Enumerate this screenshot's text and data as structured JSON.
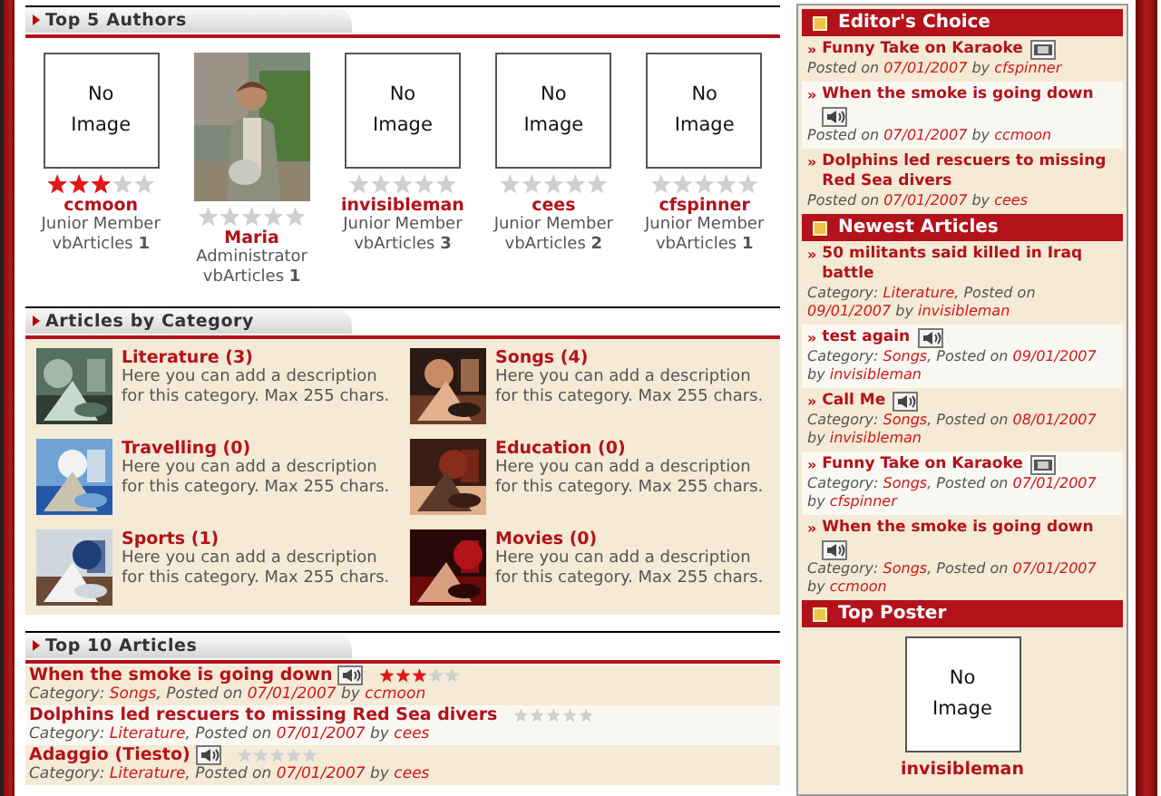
{
  "top_authors": {
    "title": "Top 5 Authors",
    "authors": [
      {
        "avatar": {
          "kind": "none",
          "text": "No Image"
        },
        "stars": 3,
        "name": "ccmoon",
        "role": "Junior Member",
        "articles": "vbArticles **1**"
      },
      {
        "stars": 0,
        "name": "Maria",
        "role": "Administrator",
        "articles": "vbArticles **1**"
      },
      {
        "avatar": {
          "kind": "none",
          "text": "No Image"
        },
        "stars": 0,
        "name": "invisibleman",
        "role": "Junior Member",
        "articles": "vbArticles **3**"
      },
      {
        "avatar": {
          "kind": "none",
          "text": "No Image"
        },
        "stars": 0,
        "name": "cees",
        "role": "Junior Member",
        "articles": "vbArticles **2**"
      },
      {
        "avatar": {
          "kind": "none",
          "text": "No Image"
        },
        "stars": 0,
        "name": "cfspinner",
        "role": "Junior Member",
        "articles": "vbArticles **1**"
      }
    ]
  },
  "categories": {
    "title": "Articles by Category",
    "items": [
      {
        "name": "Literature (3)",
        "description": "Here you can add a description for this category. Max 255 chars."
      },
      {
        "name": "Songs (4)",
        "description": "Here you can add a description for this category. Max 255 chars."
      },
      {
        "name": "Travelling (0)",
        "description": "Here you can add a description for this category. Max 255 chars."
      },
      {
        "name": "Education (0)",
        "description": "Here you can add a description for this category. Max 255 chars."
      },
      {
        "name": "Sports (1)",
        "description": "Here you can add a description for this category. Max 255 chars."
      },
      {
        "name": "Movies (0)",
        "description": "Here you can add a description for this category. Max 255 chars."
      }
    ]
  },
  "top_articles": {
    "title": "Top 10 Articles",
    "items": [
      {
        "title": "When the smoke is going down",
        "kind": "audio",
        "stars": 3,
        "category_label": "Category:",
        "category": "Songs",
        "posted_label": ", Posted on",
        "date": "07/01/2007",
        "by_label": "by",
        "author": "ccmoon"
      },
      {
        "title": "Dolphins led rescuers to missing Red Sea divers",
        "kind": "plain",
        "stars": 0,
        "category_label": "Category:",
        "category": "Literature",
        "posted_label": ", Posted on",
        "date": "07/01/2007",
        "by_label": "by",
        "author": "cees"
      },
      {
        "title": "Adaggio (Tiesto)",
        "kind": "audio",
        "stars": 0,
        "category_label": "Category:",
        "category": "Literature",
        "posted_label": ", Posted on",
        "date": "07/01/2007",
        "by_label": "by",
        "author": "cees"
      }
    ]
  },
  "editors_choice": {
    "title": "Editor's Choice",
    "items": [
      {
        "bullet": "»",
        "title": "Funny Take on Karaoke",
        "kind": "video",
        "posted_label": "Posted on",
        "date": "07/01/2007",
        "by_label": "by",
        "author": "cfspinner"
      },
      {
        "bullet": "»",
        "title": "When the smoke is going down",
        "kind": "audio",
        "posted_label": "Posted on",
        "date": "07/01/2007",
        "by_label": "by",
        "author": "ccmoon"
      },
      {
        "bullet": "»",
        "title": "Dolphins led rescuers to missing Red Sea divers",
        "kind": "plain",
        "posted_label": "Posted on",
        "date": "07/01/2007",
        "by_label": "by",
        "author": "cees"
      }
    ]
  },
  "newest_articles": {
    "title": "Newest Articles",
    "items": [
      {
        "bullet": "»",
        "title": "50 militants said killed in Iraq battle",
        "kind": "plain",
        "category_label": "Category:",
        "category": "Literature",
        "posted_label": ", Posted on",
        "date": "09/01/2007",
        "by_label": "by",
        "author": "invisibleman"
      },
      {
        "bullet": "»",
        "title": "test again",
        "kind": "audio",
        "category_label": "Category:",
        "category": "Songs",
        "posted_label": ", Posted on",
        "date": "09/01/2007",
        "by_label": "by",
        "author": "invisibleman"
      },
      {
        "bullet": "»",
        "title": "Call Me",
        "kind": "audio",
        "category_label": "Category:",
        "category": "Songs",
        "posted_label": ", Posted on",
        "date": "08/01/2007",
        "by_label": "by",
        "author": "invisibleman"
      },
      {
        "bullet": "»",
        "title": "Funny Take on Karaoke",
        "kind": "video",
        "category_label": "Category:",
        "category": "Songs",
        "posted_label": ", Posted on",
        "date": "07/01/2007",
        "by_label": "by",
        "author": "cfspinner"
      },
      {
        "bullet": "»",
        "title": "When the smoke is going down",
        "kind": "audio",
        "category_label": "Category:",
        "category": "Songs",
        "posted_label": ", Posted on",
        "date": "07/01/2007",
        "by_label": "by",
        "author": "ccmoon"
      }
    ]
  },
  "top_poster": {
    "title": "Top Poster",
    "avatar": {
      "kind": "none",
      "text": "No Image"
    },
    "name": "invisibleman"
  }
}
